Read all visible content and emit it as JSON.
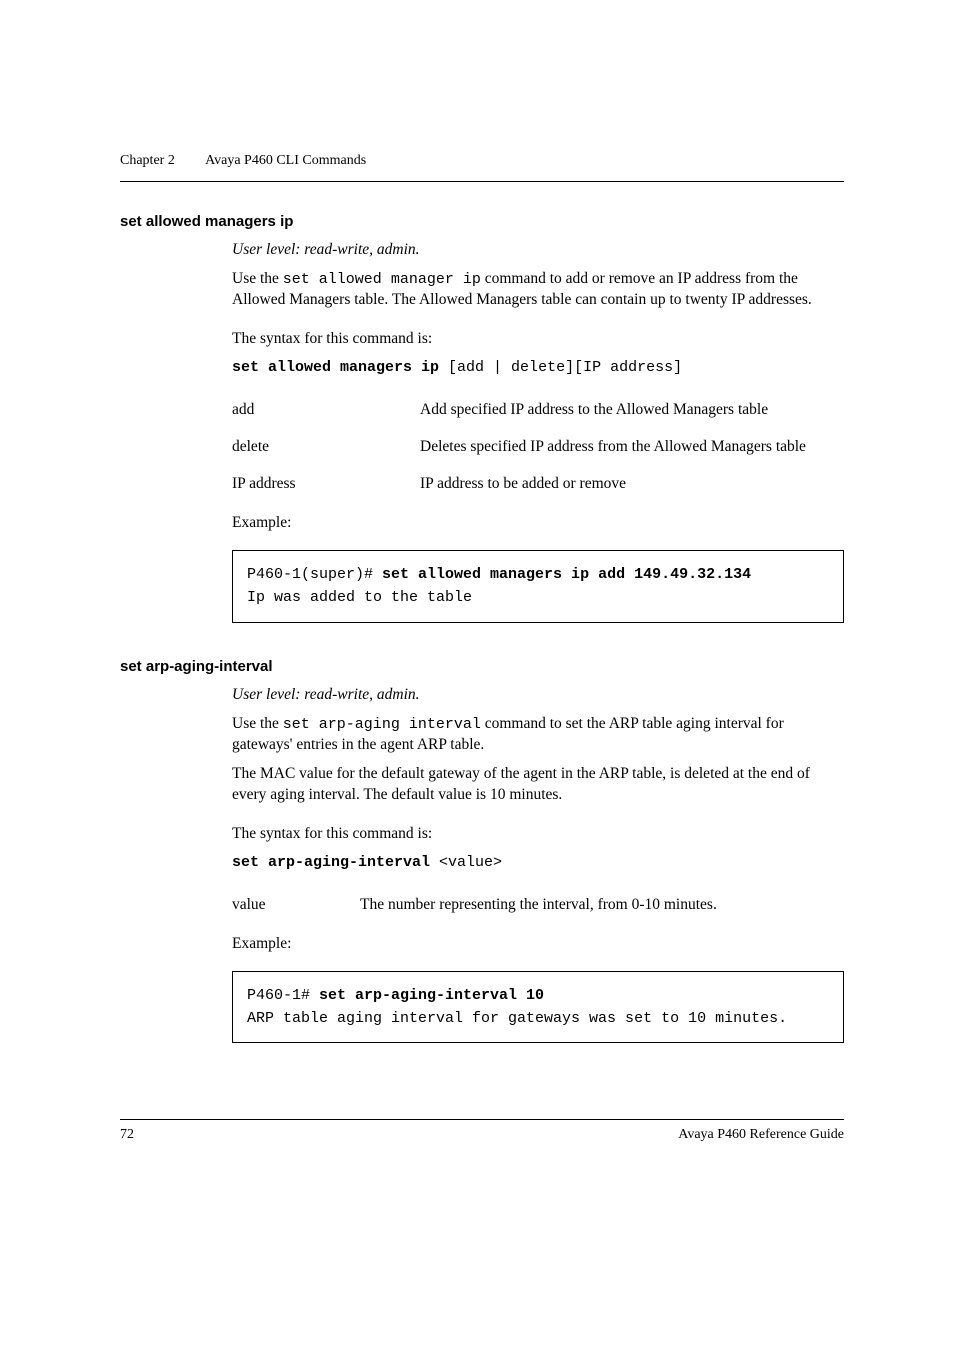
{
  "header": {
    "chapter": "Chapter 2",
    "title": "Avaya P460 CLI Commands"
  },
  "sections": [
    {
      "title": "set allowed managers ip",
      "user_level": "User level: read-write, admin.",
      "intro_parts": {
        "pre": "Use the ",
        "code": "set allowed manager ip",
        "post": " command to add or remove an IP address from the Allowed Managers table. The Allowed Managers table can contain up to twenty IP addresses."
      },
      "syntax_label": "The syntax for this command is:",
      "syntax": {
        "bold": "set allowed managers ip",
        "rest": " [add | delete][IP address]"
      },
      "args": [
        {
          "k": "add",
          "v": "Add specified IP address to the Allowed Managers table"
        },
        {
          "k": "delete",
          "v": "Deletes specified IP address from the Allowed Managers table"
        },
        {
          "k": "IP address",
          "v": "IP address to be added or remove"
        }
      ],
      "example_label": "Example:",
      "example": {
        "prompt": "P460-1(super)# ",
        "cmd": "set allowed managers ip add 149.49.32.134",
        "out": "Ip was added to the table"
      }
    },
    {
      "title": "set arp-aging-interval",
      "user_level": "User level: read-write, admin.",
      "intro_parts": {
        "pre": "Use the ",
        "code": "set arp-aging interval",
        "post": " command to set the ARP table aging interval for gateways' entries in the agent ARP table."
      },
      "extra": "The MAC value for the default gateway of the agent in the ARP table, is deleted at the end of every aging interval. The default value is 10 minutes.",
      "syntax_label": "The syntax for this command is:",
      "syntax": {
        "bold": "set arp-aging-interval",
        "rest": " <value>"
      },
      "args": [
        {
          "k": "value",
          "v": "The number representing the interval, from 0-10 minutes."
        }
      ],
      "example_label": "Example:",
      "example": {
        "prompt": "P460-1# ",
        "cmd": "set arp-aging-interval 10",
        "out": "ARP table aging interval for gateways was set to 10 minutes."
      }
    }
  ],
  "footer": {
    "page": "72",
    "doc": "Avaya P460 Reference Guide"
  }
}
